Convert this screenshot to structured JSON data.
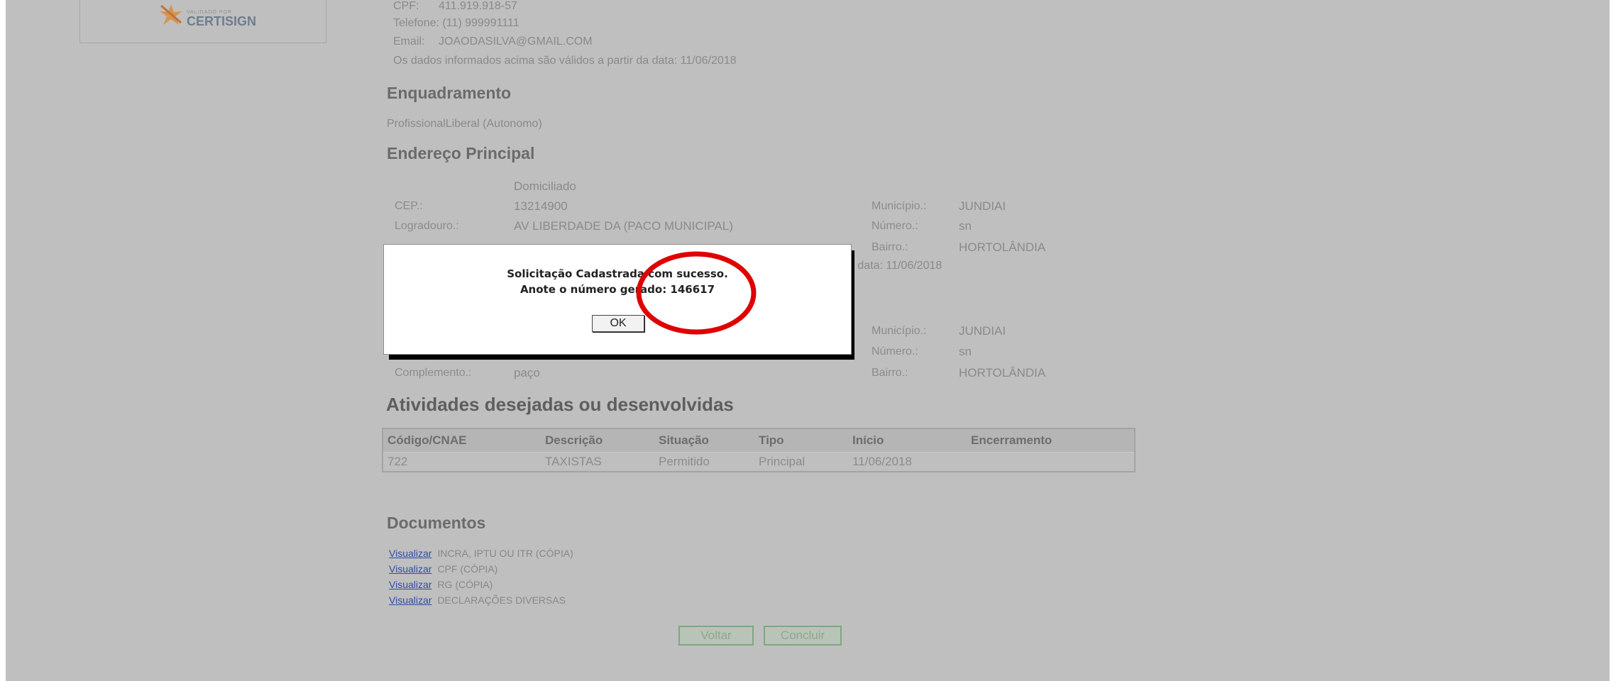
{
  "logo": {
    "small_text": "VALIDADO POR",
    "brand": "CERTISIGN"
  },
  "person": {
    "cpf_label": "CPF:",
    "cpf_value": "411.919.918-57",
    "telefone": "Telefone: (11) 999991111",
    "email_label": "Email:",
    "email_value": "JOAODASILVA@GMAIL.COM",
    "valid_note": "Os dados informados acima são válidos a partir da data: 11/06/2018"
  },
  "enquadramento": {
    "title": "Enquadramento",
    "value": "ProfissionalLiberal (Autonomo)"
  },
  "endereco_principal": {
    "title": "Endereço Principal",
    "tipo": "Domiciliado",
    "cep_label": "CEP.:",
    "cep_value": "13214900",
    "logradouro_label": "Logradouro.:",
    "logradouro_value": "AV LIBERDADE DA (PACO MUNICIPAL)",
    "municipio_label": "Município.:",
    "municipio_value": "JUNDIAI",
    "numero_label": "Número.:",
    "numero_value": "sn",
    "bairro_label": "Bairro.:",
    "bairro_value": "HORTOLÂNDIA",
    "valid_fragment": "a data: 11/06/2018"
  },
  "endereco_2": {
    "municipio_label": "Município.:",
    "municipio_value": "JUNDIAI",
    "numero_label": "Número.:",
    "numero_value": "sn",
    "complemento_label": "Complemento.:",
    "complemento_value": "paço",
    "bairro_label": "Bairro.:",
    "bairro_value": "HORTOLÂNDIA"
  },
  "atividades": {
    "title": "Atividades desejadas ou desenvolvidas",
    "columns": [
      "Código/CNAE",
      "Descrição",
      "Situação",
      "Tipo",
      "Início",
      "Encerramento"
    ],
    "rows": [
      [
        "722",
        "TAXISTAS",
        "Permitido",
        "Principal",
        "11/06/2018",
        ""
      ]
    ]
  },
  "documentos": {
    "title": "Documentos",
    "link_label": "Visualizar",
    "items": [
      "INCRA, IPTU OU ITR (CÓPIA)",
      "CPF (CÓPIA)",
      "RG (CÓPIA)",
      "DECLARAÇÕES DIVERSAS"
    ]
  },
  "buttons": {
    "voltar": "Voltar",
    "concluir": "Concluir"
  },
  "modal": {
    "line1": "Solicitação Cadastrada com sucesso.",
    "line2": "Anote o número gerado: 146617",
    "ok": "OK",
    "highlight_color": "#e00000"
  }
}
